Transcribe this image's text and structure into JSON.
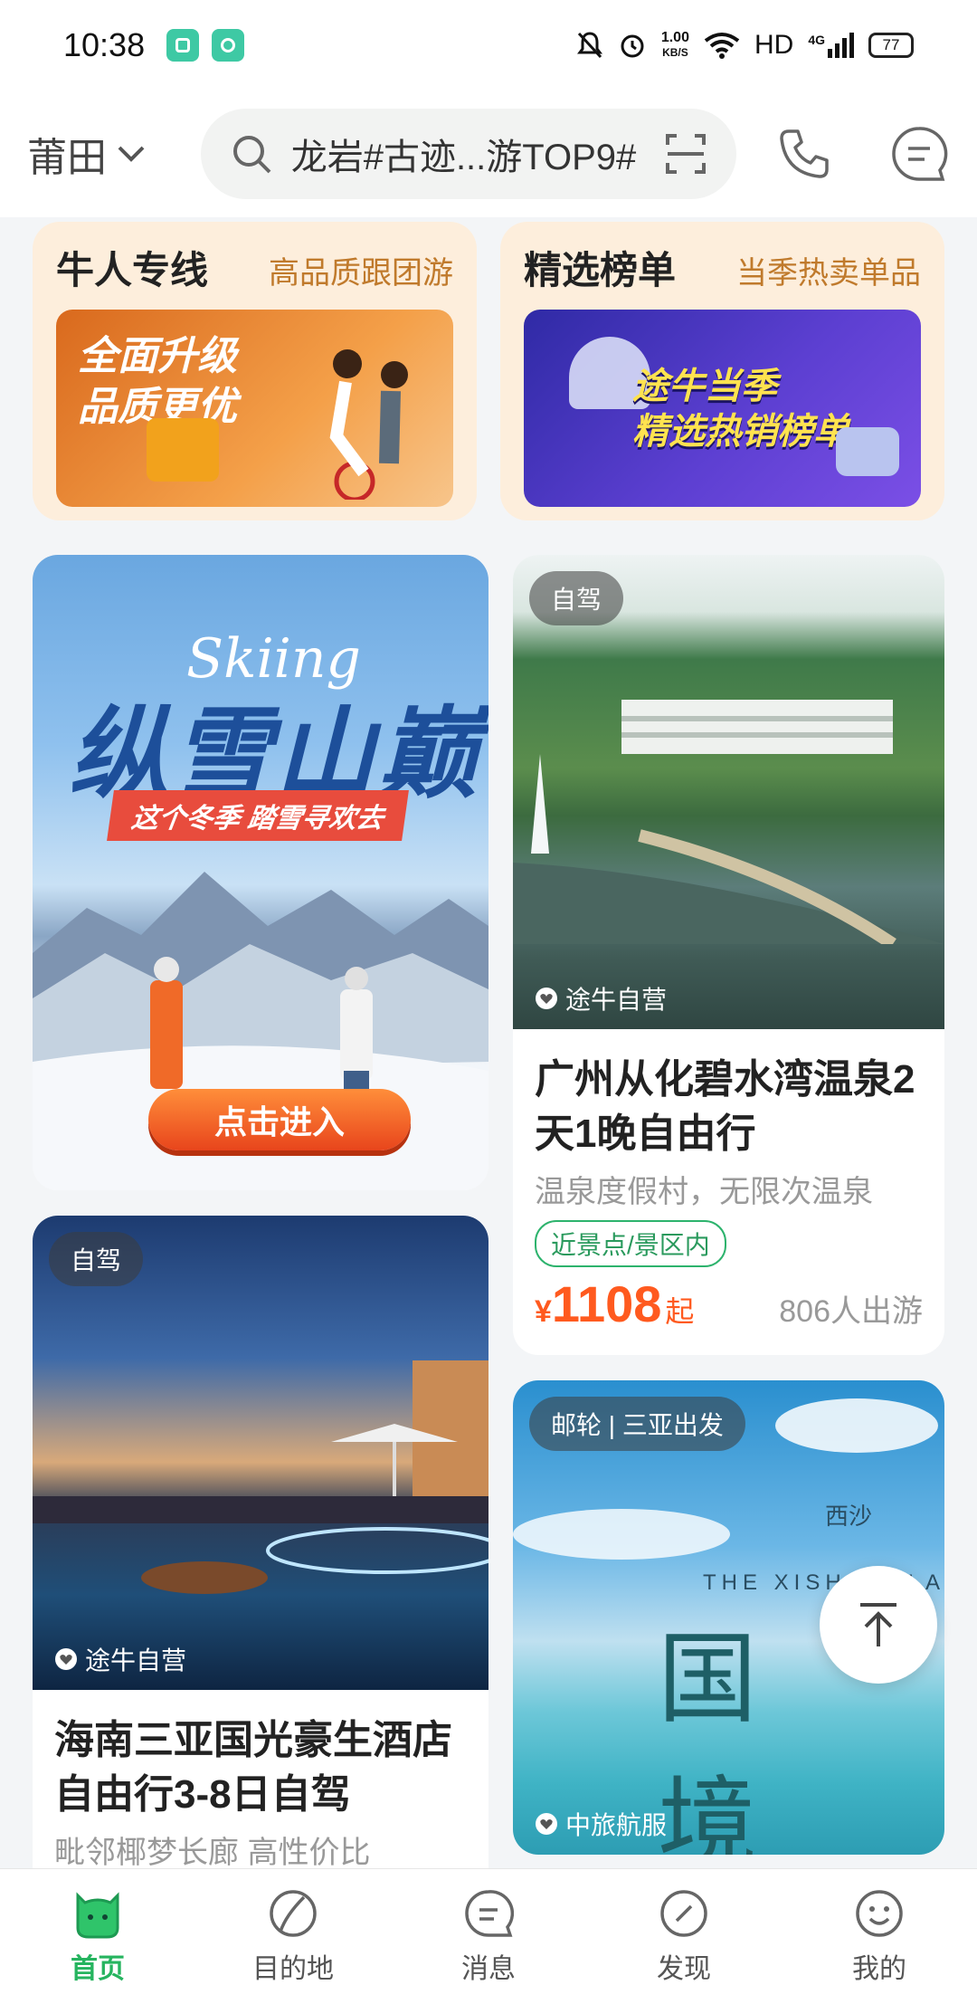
{
  "status_bar": {
    "time": "10:38",
    "net_speed_top": "1.00",
    "net_speed_bottom": "KB/S",
    "hd": "HD",
    "signal": "4G",
    "battery": "77"
  },
  "header": {
    "city": "莆田",
    "search_text": "龙岩#古迹...游TOP9#",
    "icons": [
      "search-icon",
      "scan-icon",
      "phone-icon",
      "message-icon"
    ]
  },
  "promos": [
    {
      "title": "牛人专线",
      "subtitle": "高品质跟团游",
      "banner_text": "全面升级\n品质更优"
    },
    {
      "title": "精选榜单",
      "subtitle": "当季热卖单品",
      "banner_text": "途牛当季\n精选热销榜单"
    }
  ],
  "ski_banner": {
    "script": "Skiing",
    "title": "纵雪山巅",
    "strip": "这个冬季  踏雪寻欢去",
    "button": "点击进入"
  },
  "products": {
    "resort": {
      "tag": "自驾",
      "brand": "途牛自营",
      "title": "广州从化碧水湾温泉2天1晚自由行",
      "subtitle": "温泉度假村，无限次温泉",
      "feature_tag": "近景点/景区内",
      "currency": "¥",
      "price": "1108",
      "price_unit": "起",
      "travelers": "806人出游"
    },
    "sanya": {
      "tag": "自驾",
      "brand": "途牛自营",
      "title": "海南三亚国光豪生酒店自由行3-8日自驾",
      "subtitle": "毗邻椰梦长廊  高性价比"
    },
    "sea": {
      "tag": "邮轮 | 三亚出发",
      "brand": "中旅航服",
      "cn_small": "西沙",
      "en_text": "THE XISHA ISLA",
      "cn_big": "国境"
    }
  },
  "bottom_nav": [
    {
      "label": "首页",
      "icon": "home-icon",
      "active": true
    },
    {
      "label": "目的地",
      "icon": "destination-icon",
      "active": false
    },
    {
      "label": "消息",
      "icon": "message-icon",
      "active": false
    },
    {
      "label": "发现",
      "icon": "discover-icon",
      "active": false
    },
    {
      "label": "我的",
      "icon": "profile-icon",
      "active": false
    }
  ],
  "colors": {
    "accent_green": "#26b45f",
    "price_orange": "#ff5a1f",
    "promo_bg": "#fdeedc"
  }
}
